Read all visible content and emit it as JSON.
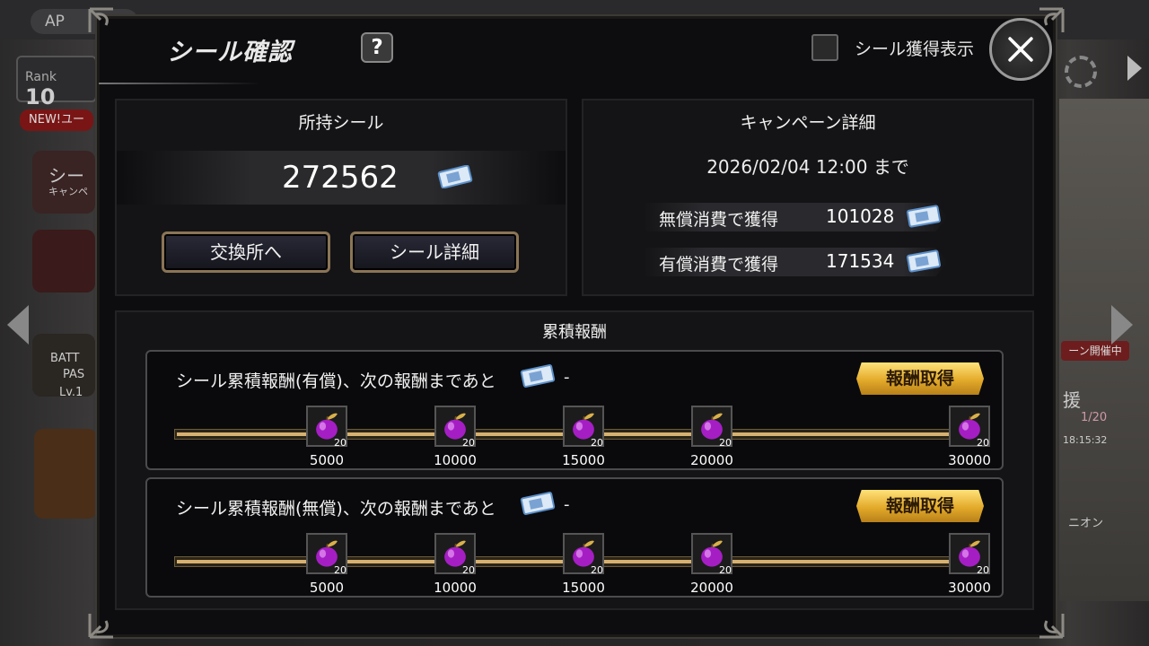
{
  "background": {
    "ap_label": "AP",
    "rank_label": "Rank",
    "rank_value": "10",
    "new_tag": "NEW!ユー",
    "campaign_tag": "ーン開催中",
    "side_labels": [
      "シー",
      "キャンペ",
      "BATT",
      "PAS",
      "Lv.1",
      "援",
      "1/20",
      "18:15:32",
      "ニオン"
    ]
  },
  "modal": {
    "title": "シール確認",
    "help_label": "?",
    "toggle_label": "シール獲得表示",
    "close_label": "close"
  },
  "owned": {
    "header": "所持シール",
    "amount": "272562",
    "exchange_button": "交換所へ",
    "detail_button": "シール詳細"
  },
  "campaign": {
    "header": "キャンペーン詳細",
    "deadline": "2026/02/04 12:00 まで",
    "free_label": "無償消費で獲得",
    "free_value": "101028",
    "paid_label": "有償消費で獲得",
    "paid_value": "171534"
  },
  "rewards": {
    "header": "累積報酬",
    "tracks": [
      {
        "title": "シール累積報酬(有償)、次の報酬まであと",
        "remaining": "-",
        "claim_button": "報酬取得",
        "progress": 1.0,
        "milestones": [
          {
            "threshold": "5000",
            "qty": "20"
          },
          {
            "threshold": "10000",
            "qty": "20"
          },
          {
            "threshold": "15000",
            "qty": "20"
          },
          {
            "threshold": "20000",
            "qty": "20"
          },
          {
            "threshold": "30000",
            "qty": "20"
          }
        ]
      },
      {
        "title": "シール累積報酬(無償)、次の報酬まであと",
        "remaining": "-",
        "claim_button": "報酬取得",
        "progress": 1.0,
        "milestones": [
          {
            "threshold": "5000",
            "qty": "20"
          },
          {
            "threshold": "10000",
            "qty": "20"
          },
          {
            "threshold": "15000",
            "qty": "20"
          },
          {
            "threshold": "20000",
            "qty": "20"
          },
          {
            "threshold": "30000",
            "qty": "20"
          }
        ]
      }
    ]
  },
  "icons": {
    "seal": "seal-ticket-icon",
    "reward_item": "purple-apple-icon"
  },
  "colors": {
    "accent_gold": "#e3aa2a",
    "bar_fill": "#d7b170",
    "button_border": "#8b7556"
  }
}
